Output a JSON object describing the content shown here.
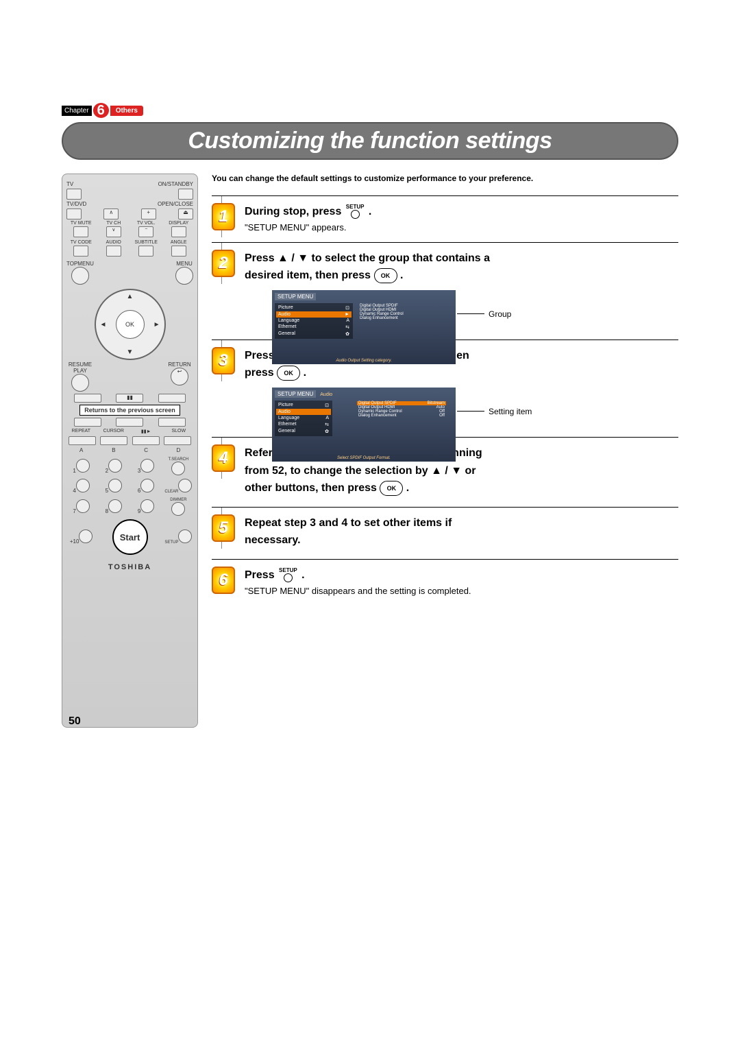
{
  "chapter": {
    "caption": "Chapter",
    "number": "6",
    "label": "Others"
  },
  "title": "Customizing the function settings",
  "intro": "You can change the default settings to customize performance to your preference.",
  "steps": {
    "s1": {
      "title_pre": "During stop, press ",
      "icon_label": "SETUP",
      "title_post": ".",
      "sub": "\"SETUP MENU\" appears."
    },
    "s2": {
      "line1": "Press ▲ / ▼ to select the group that contains a",
      "line2_pre": "desired item, then press ",
      "ok": "OK",
      "line2_post": "."
    },
    "s3": {
      "line1": "Press ▲ / ▼ to select the setting item, then",
      "line2_pre": "press ",
      "ok": "OK",
      "line2_post": "."
    },
    "s4": {
      "line1": "Refer to the explanations on pages beginning",
      "line2": "from 52, to change the selection by ▲ / ▼ or",
      "line3_pre": "other buttons, then press ",
      "ok": "OK",
      "line3_post": "."
    },
    "s5": {
      "line1": "Repeat step 3 and 4 to set other items if",
      "line2": "necessary."
    },
    "s6": {
      "title_pre": "Press ",
      "icon_label": "SETUP",
      "title_post": ".",
      "sub": "\"SETUP MENU\" disappears and the setting is completed."
    }
  },
  "screen1": {
    "title": "SETUP MENU",
    "items": [
      "Picture",
      "Audio",
      "Language",
      "Ethernet",
      "General"
    ],
    "side": [
      "Digital Output SPDIF",
      "Digital Output HDMI",
      "Dynamic Range Control",
      "Dialog Enhancement"
    ],
    "foot": "Audio Output Setting category.",
    "anno": "Group"
  },
  "screen2": {
    "title": "SETUP MENU",
    "crumb": "Audio",
    "items": [
      "Picture",
      "Audio",
      "Language",
      "Ethernet",
      "General"
    ],
    "side": [
      {
        "k": "Digital Output SPDIF",
        "v": "Bitstream"
      },
      {
        "k": "Digital Output HDMI",
        "v": "Auto"
      },
      {
        "k": "Dynamic Range Control",
        "v": "Off"
      },
      {
        "k": "Dialog Enhancement",
        "v": "Off"
      }
    ],
    "foot": "Select SPDIF Output Format.",
    "anno": "Setting item"
  },
  "remote": {
    "row1": [
      "TV",
      "ON/STANDBY"
    ],
    "row2": [
      "TV/DVD",
      "OPEN/CLOSE"
    ],
    "row3": [
      "TV MUTE",
      "TV CH",
      "TV VOL.",
      "DISPLAY"
    ],
    "row4": [
      "TV CODE",
      "AUDIO",
      "SUBTITLE",
      "ANGLE"
    ],
    "row5_left": "TOPMENU",
    "row5_right": "MENU",
    "ok": "OK",
    "row6_left": "RESUME PLAY",
    "row6_right": "RETURN",
    "callout": "Returns to the previous screen",
    "row8": [
      "REPEAT",
      "CURSOR",
      "",
      "SLOW"
    ],
    "letters": [
      "A",
      "B",
      "C",
      "D"
    ],
    "nums_r1": [
      "1",
      "2",
      "3",
      "T.SEARCH"
    ],
    "nums_r2": [
      "4",
      "5",
      "6",
      "CLEAR"
    ],
    "nums_r3": [
      "7",
      "8",
      "9",
      "DIMMER"
    ],
    "nums_r4_left": "+10",
    "nums_r4_right": "SETUP",
    "start": "Start",
    "brand": "TOSHIBA"
  },
  "page_number": "50"
}
